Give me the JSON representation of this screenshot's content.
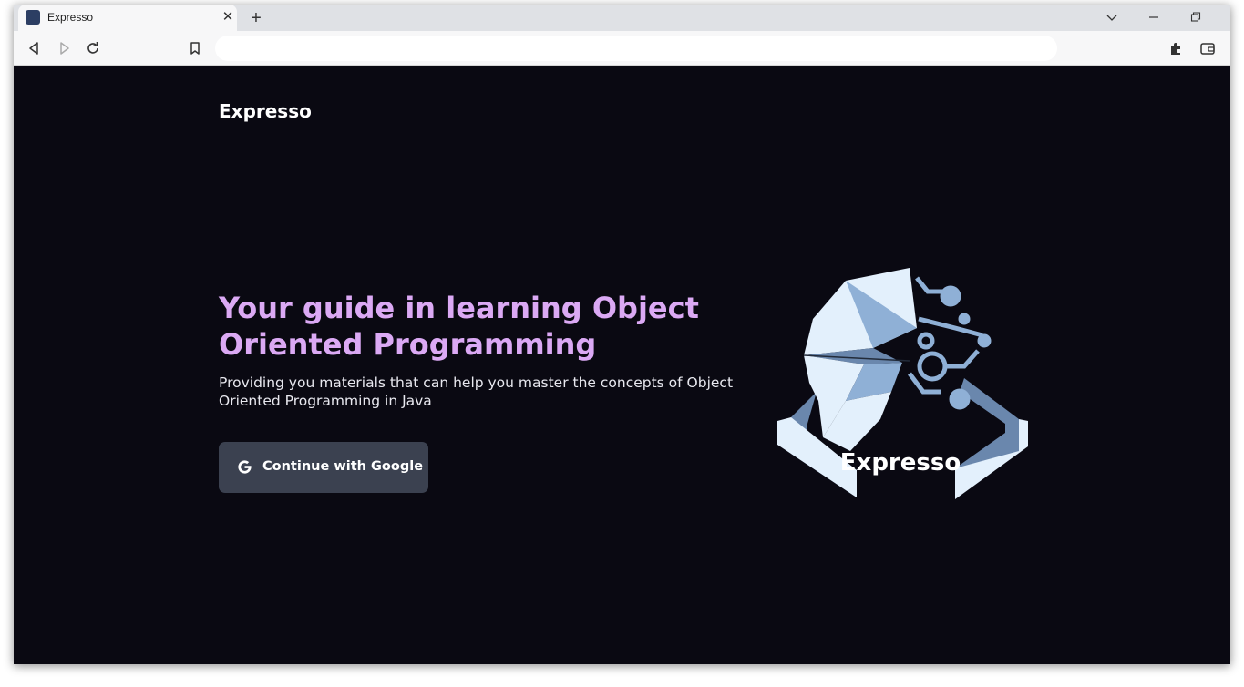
{
  "browser": {
    "tab_title": "Expresso",
    "tab_close": "✕",
    "new_tab": "+",
    "icons": [
      "chevron-down-icon",
      "minimize-icon",
      "restore-icon",
      "back-icon",
      "forward-icon",
      "reload-icon",
      "bookmark-icon",
      "extensions-icon",
      "wallet-icon"
    ],
    "address": ""
  },
  "header": {
    "brand": "Expresso"
  },
  "hero": {
    "title": "Your guide in learning Object Oriented Programming",
    "subtitle": "Providing you materials that can help you master the concepts of Object Oriented Programming in Java",
    "button_label": "Continue with Google",
    "button_icon": "google-icon"
  },
  "logo": {
    "text": "Expresso"
  },
  "colors": {
    "page_bg": "#0a0912",
    "title": "#dba9f4",
    "button_bg": "#3b4150",
    "logo_light": "#e3f0fc",
    "logo_mid": "#8fb0d6",
    "logo_dark": "#6a87ad"
  }
}
